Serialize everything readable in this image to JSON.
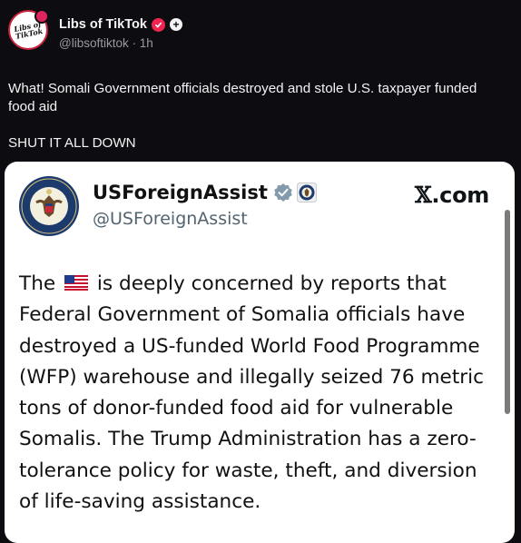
{
  "post": {
    "avatar_text": "Libs of\nTikTok",
    "author_name": "Libs of TikTok",
    "verified_icon": "verified-badge-icon",
    "subscribe_icon": "plus-icon",
    "plus_symbol": "+",
    "handle": "@libsoftiktok",
    "separator": "·",
    "time": "1h",
    "text_line1": "What! Somali Government officials destroyed and stole U.S. taxpayer funded food aid",
    "text_line2": "SHUT IT ALL DOWN"
  },
  "embed": {
    "avatar_icon": "dept-of-state-seal-icon",
    "name": "USForeignAssist",
    "verified_icon": "gray-verified-badge-icon",
    "org_icon": "government-seal-icon",
    "handle": "@USForeignAssist",
    "source_mark": "𝕏",
    "source_suffix": ".com",
    "text_before_flag": "The",
    "flag_icon": "us-flag-emoji",
    "text_after_flag": "is deeply concerned by reports that Federal Government of Somalia officials have destroyed a US-funded World Food Programme (WFP) warehouse and illegally seized 76 metric tons of donor-funded food aid for vulnerable Somalis. The Trump Administration has a zero-tolerance policy for waste, theft, and diversion of life-saving assistance."
  },
  "colors": {
    "background": "#0c0c11",
    "verified_badge": "#f2234f",
    "embed_background": "#ffffff",
    "embed_handle": "#536471"
  }
}
